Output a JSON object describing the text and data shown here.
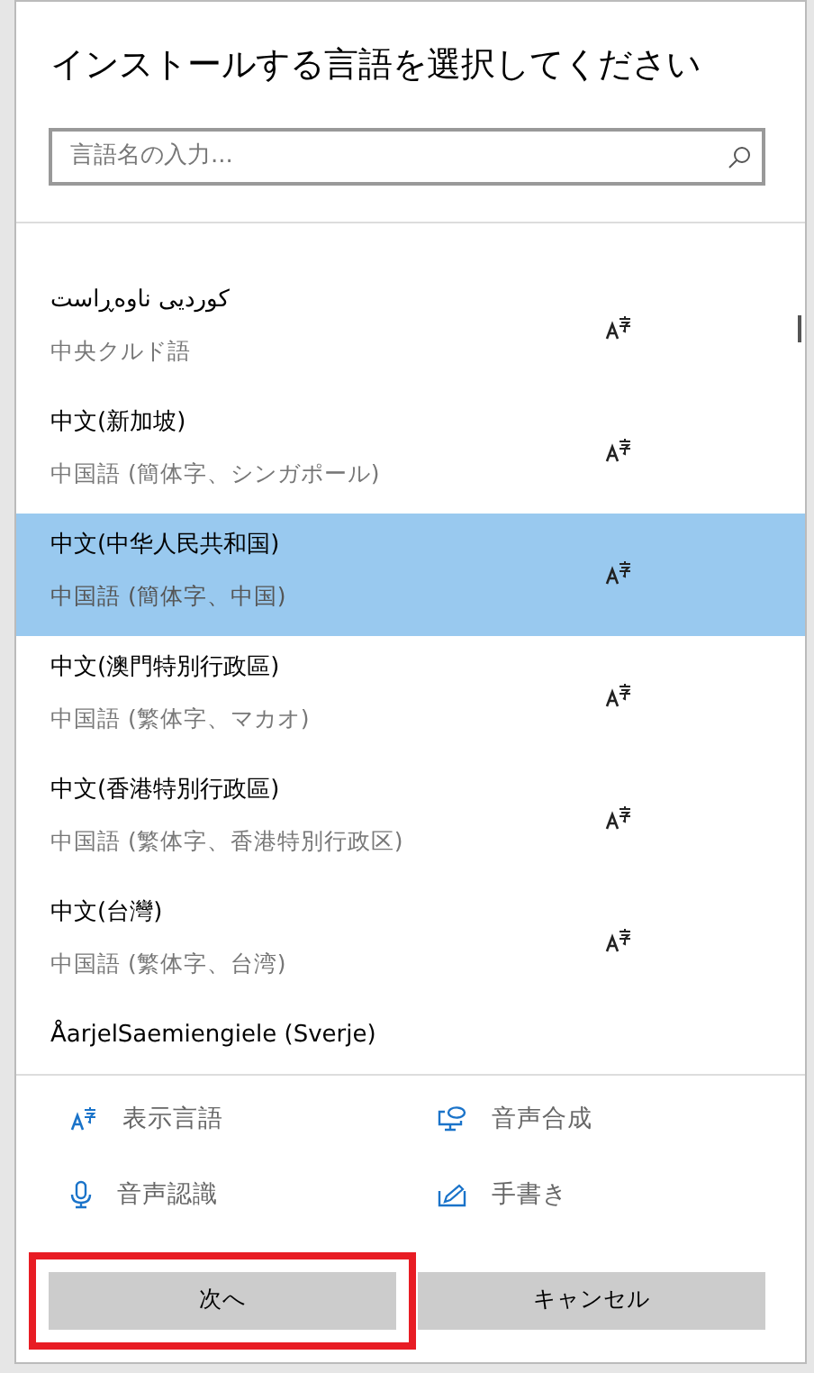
{
  "title": "インストールする言語を選択してください",
  "search": {
    "placeholder": "言語名の入力..."
  },
  "languages": [
    {
      "name": "کوردیی ناوەڕاست",
      "subtitle": "中央クルド語",
      "display_language": true,
      "selected": false
    },
    {
      "name": "中文(新加坡)",
      "subtitle": "中国語 (簡体字、シンガポール)",
      "display_language": true,
      "selected": false
    },
    {
      "name": "中文(中华人民共和国)",
      "subtitle": "中国語 (簡体字、中国)",
      "display_language": true,
      "selected": true
    },
    {
      "name": "中文(澳門特別行政區)",
      "subtitle": "中国語 (繁体字、マカオ)",
      "display_language": true,
      "selected": false
    },
    {
      "name": "中文(香港特別行政區)",
      "subtitle": "中国語 (繁体字、香港特別行政区)",
      "display_language": true,
      "selected": false
    },
    {
      "name": "中文(台灣)",
      "subtitle": "中国語 (繁体字、台湾)",
      "display_language": true,
      "selected": false
    },
    {
      "name": "ÅarjelSaemiengiele (Sverje)",
      "display_language": false,
      "selected": false
    }
  ],
  "features": [
    {
      "kind": "display",
      "label": "表示言語"
    },
    {
      "kind": "tts",
      "label": "音声合成"
    },
    {
      "kind": "speech",
      "label": "音声認識"
    },
    {
      "kind": "handwriting",
      "label": "手書き"
    }
  ],
  "buttons": [
    {
      "label": "次へ",
      "highlighted": true
    },
    {
      "label": "キャンセル",
      "highlighted": false
    }
  ]
}
